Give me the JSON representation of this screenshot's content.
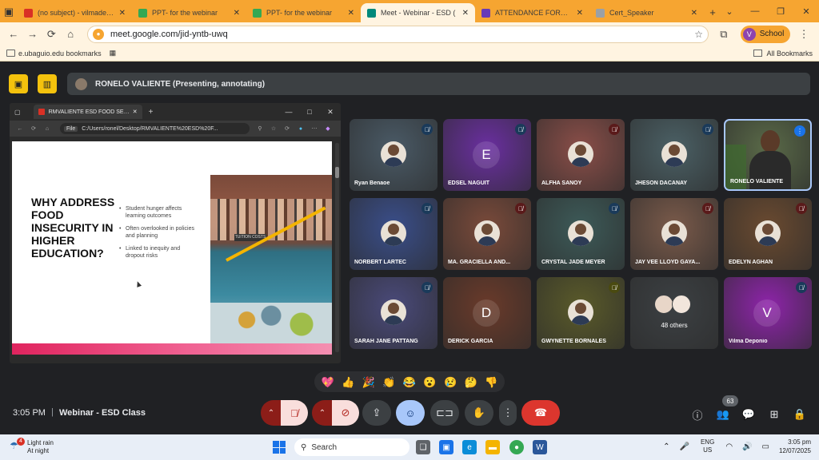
{
  "browser": {
    "tabs": [
      {
        "title": "(no subject) - vilmadeponio",
        "icon": "gmail-icon",
        "color": "#d93025"
      },
      {
        "title": "PPT- for the webinar",
        "icon": "slides-icon",
        "color": "#34a853"
      },
      {
        "title": "PPT- for the webinar",
        "icon": "slides-icon",
        "color": "#34a853"
      },
      {
        "title": "Meet - Webinar - ESD (",
        "icon": "meet-icon",
        "color": "#00897b",
        "active": true
      },
      {
        "title": "ATTENDANCE FORM FOR",
        "icon": "forms-icon",
        "color": "#673ab7"
      },
      {
        "title": "Cert_Speaker",
        "icon": "globe-icon",
        "color": "#9aa0a6"
      }
    ],
    "url": "meet.google.com/jid-yntb-uwq",
    "profile_label": "School",
    "profile_initial": "V",
    "bookmarks": [
      "e.ubaguio.edu bookmarks"
    ],
    "all_bookmarks": "All Bookmarks"
  },
  "meet": {
    "presenter_label": "RONELO VALIENTE (Presenting, annotating)",
    "time": "3:05 PM",
    "separator": "|",
    "meeting_name": "Webinar - ESD Class",
    "people_count": "63",
    "reactions": [
      "💖",
      "👍",
      "🎉",
      "👏",
      "😂",
      "😮",
      "😢",
      "🤔",
      "👎"
    ]
  },
  "share": {
    "tab_title": "RMVALIENTE ESD FOOD SECURI",
    "file_label": "File",
    "path": "C:/Users/ronel/Desktop/RMVALIENTE%20ESD%20F...",
    "slide": {
      "title": "WHY ADDRESS FOOD INSECURITY IN HIGHER EDUCATION?",
      "bullets": [
        "Student hunger affects learning outcomes",
        "Often overlooked in policies and planning",
        "Linked to inequity and dropout risks"
      ],
      "sign": "TUITION COSTS"
    }
  },
  "participants": [
    {
      "name": "Ryan Benaoe",
      "bg": "#4a5a66",
      "kind": "photo",
      "mic": "off-blue"
    },
    {
      "name": "EDSEL NAGUIT",
      "bg": "#6a2fa0",
      "kind": "letter",
      "letter": "E",
      "mic": "off-blue"
    },
    {
      "name": "ALFHA SANOY",
      "bg": "#8a4e48",
      "kind": "photo",
      "mic": "off-red"
    },
    {
      "name": "JHESON DACANAY",
      "bg": "#4b6065",
      "kind": "photo",
      "mic": "off-blue"
    },
    {
      "name": "RONELO VALIENTE",
      "bg": "#5a6a48",
      "kind": "video",
      "mic": "on",
      "speaking": true
    },
    {
      "name": "NORBERT LARTEC",
      "bg": "#3a4e8a",
      "kind": "photo",
      "mic": "off-blue"
    },
    {
      "name": "MA. GRACIELLA AND...",
      "bg": "#7a4a3a",
      "kind": "photo",
      "mic": "off-red"
    },
    {
      "name": "CRYSTAL JADE MEYER",
      "bg": "#3d5a58",
      "kind": "photo",
      "mic": "off-blue"
    },
    {
      "name": "JAY VEE LLOYD GAYA...",
      "bg": "#7a5a4a",
      "kind": "photo",
      "mic": "off-red"
    },
    {
      "name": "EDELYN AGHAN",
      "bg": "#6a4a30",
      "kind": "photo",
      "mic": "off-red"
    },
    {
      "name": "SARAH JANE PATTANG",
      "bg": "#4a4a7a",
      "kind": "photo",
      "mic": "off-blue"
    },
    {
      "name": "DERICK GARCIA",
      "bg": "#6a3a2a",
      "kind": "letter",
      "letter": "D",
      "mic": ""
    },
    {
      "name": "GWYNETTE BORNALES",
      "bg": "#5a5a2a",
      "kind": "photo",
      "mic": "off-yellow"
    },
    {
      "name": "48 others",
      "bg": "#3c4043",
      "kind": "others",
      "mic": ""
    },
    {
      "name": "Vilma Deponio",
      "bg": "#8e24aa",
      "kind": "letter",
      "letter": "V",
      "mic": "off-blue"
    }
  ],
  "taskbar": {
    "weather_line1": "Light rain",
    "weather_line2": "At night",
    "weather_badge": "4",
    "search_label": "Search",
    "lang1": "ENG",
    "lang2": "US",
    "time": "3:05 pm",
    "date": "12/07/2025"
  }
}
